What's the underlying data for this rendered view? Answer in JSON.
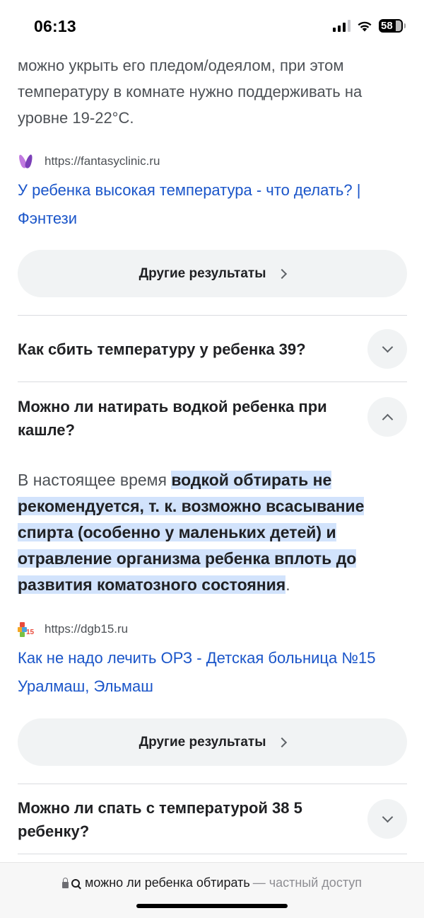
{
  "status_bar": {
    "time": "06:13",
    "battery": "58"
  },
  "first_result": {
    "snippet": "можно укрыть его пледом/одеялом, при этом температуру в комнате нужно поддерживать на уровне 19-22°C.",
    "source_url": "https://fantasyclinic.ru",
    "title": "У ребенка высокая температура - что делать? | Фэнтези",
    "more_button": "Другие результаты"
  },
  "faq": {
    "q1": "Как сбить температуру у ребенка 39?",
    "q2": "Можно ли натирать водкой ребенка при кашле?",
    "answer_plain_start": "В настоящее время ",
    "answer_highlight": "водкой обтирать не рекомендуется, т. к. возможно всасывание спирта (особенно у маленьких детей) и отравление организма ребенка вплоть до развития коматозного состояния",
    "answer_plain_end": ".",
    "answer_source_url": "https://dgb15.ru",
    "answer_title": "Как не надо лечить ОРЗ - Детская больница №15 Уралмаш, Эльмаш",
    "more_button": "Другие результаты",
    "q3": "Можно ли спать с температурой 38 5 ребенку?"
  },
  "address_bar": {
    "query": "можно ли ребенка обтирать",
    "mode": "— частный доступ"
  }
}
